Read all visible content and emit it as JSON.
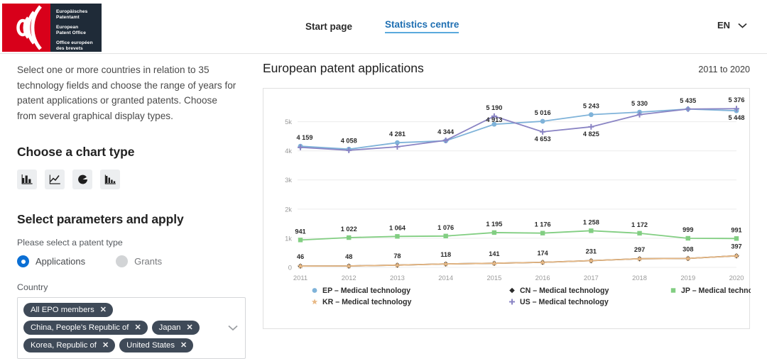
{
  "header": {
    "logo": {
      "line_de": "Europäisches<br>Patentamt",
      "line_en": "European<br>Patent Office",
      "line_fr": "Office européen<br>des brevets",
      "brand_color": "#d8001a",
      "panel_color": "#1f2b38"
    },
    "nav": [
      {
        "label": "Start page",
        "active": false
      },
      {
        "label": "Statistics centre",
        "active": true
      }
    ],
    "language": {
      "label": "EN",
      "icon": "chevron-down-icon"
    }
  },
  "sidebar": {
    "intro": "Select one or more countries in relation to 35 technology fields and choose the range of years for patent applications or granted patents. Choose from several graphical display types.",
    "chart_type_heading": "Choose a chart type",
    "chart_types": [
      {
        "name": "bar-chart-icon",
        "label": "Bar chart"
      },
      {
        "name": "line-chart-icon",
        "label": "Line chart"
      },
      {
        "name": "pie-chart-icon",
        "label": "Pie chart"
      },
      {
        "name": "column-chart-icon",
        "label": "Column chart"
      }
    ],
    "params_heading": "Select parameters and apply",
    "patent_type_label": "Please select a patent type",
    "patent_types": [
      {
        "label": "Applications",
        "selected": true
      },
      {
        "label": "Grants",
        "selected": false
      }
    ],
    "country_label": "Country",
    "country_tags": [
      "All EPO members",
      "China, People's Republic of",
      "Japan",
      "Korea, Republic of",
      "United States"
    ],
    "remove_icon": "close-icon",
    "dropdown_icon": "chevron-down-icon"
  },
  "chart_panel": {
    "title": "European patent applications",
    "range": "2011 to 2020"
  },
  "chart_data": {
    "type": "line",
    "title": "European patent applications",
    "subtitle": "2011 to 2020",
    "xlabel": "",
    "ylabel": "",
    "categories": [
      "2011",
      "2012",
      "2013",
      "2014",
      "2015",
      "2016",
      "2017",
      "2018",
      "2019",
      "2020"
    ],
    "ylim": [
      0,
      5600
    ],
    "yticks": [
      0,
      1000,
      2000,
      3000,
      4000,
      5000
    ],
    "ytick_labels": [
      "0",
      "1k",
      "2k",
      "3k",
      "4k",
      "5k"
    ],
    "grid": true,
    "legend_position": "bottom",
    "series": [
      {
        "name": "EP – Medical technology",
        "color": "#7FB3D9",
        "marker": "circle",
        "values": [
          4159,
          4058,
          4281,
          4344,
          4913,
          5016,
          5243,
          5330,
          5435,
          5376
        ],
        "labels": [
          "4 159",
          "4 058",
          "4 281",
          "4 344",
          "4 913",
          "5 016",
          "5 243",
          "5 330",
          "5 435",
          "5 376"
        ]
      },
      {
        "name": "CN – Medical technology",
        "color": "#2b2b2b",
        "marker": "diamond",
        "values": [
          46,
          48,
          78,
          118,
          141,
          174,
          231,
          297,
          308,
          397
        ],
        "labels": [
          "46",
          "48",
          "78",
          "118",
          "141",
          "174",
          "231",
          "297",
          "308",
          "397"
        ]
      },
      {
        "name": "JP – Medical technology",
        "color": "#82CE82",
        "marker": "square",
        "values": [
          941,
          1022,
          1064,
          1076,
          1195,
          1176,
          1258,
          1172,
          999,
          991
        ],
        "labels": [
          "941",
          "1 022",
          "1 064",
          "1 076",
          "1 195",
          "1 176",
          "1 258",
          "1 172",
          "999",
          "991"
        ]
      },
      {
        "name": "KR – Medical technology",
        "color": "#E8B985",
        "marker": "star",
        "values": [
          46,
          48,
          78,
          118,
          141,
          174,
          231,
          297,
          308,
          397
        ],
        "labels": []
      },
      {
        "name": "US – Medical technology",
        "color": "#8A84C4",
        "marker": "cross",
        "values": [
          4120,
          4020,
          4140,
          4360,
          5190,
          4653,
          4825,
          5243,
          5435,
          5448
        ],
        "labels": [
          "",
          "",
          "",
          "",
          "5 190",
          "4 653",
          "4 825",
          "5 330",
          "",
          "5 448"
        ]
      }
    ],
    "point_labels": {
      "top_line": [
        "4 159",
        "4 058",
        "4 281",
        "4 344",
        "5 190",
        "5 016",
        "5 243",
        "5 330",
        "5 435",
        "5 376"
      ],
      "second_line": [
        "",
        "",
        "",
        "",
        "4 913",
        "4 653",
        "4 825",
        "",
        "",
        "5 448"
      ],
      "mid_line": [
        "941",
        "1 022",
        "1 064",
        "1 076",
        "1 195",
        "1 176",
        "1 258",
        "1 172",
        "999",
        "991"
      ],
      "bottom_line": [
        "46",
        "48",
        "78",
        "118",
        "141",
        "174",
        "231",
        "297",
        "308",
        "397"
      ]
    }
  }
}
